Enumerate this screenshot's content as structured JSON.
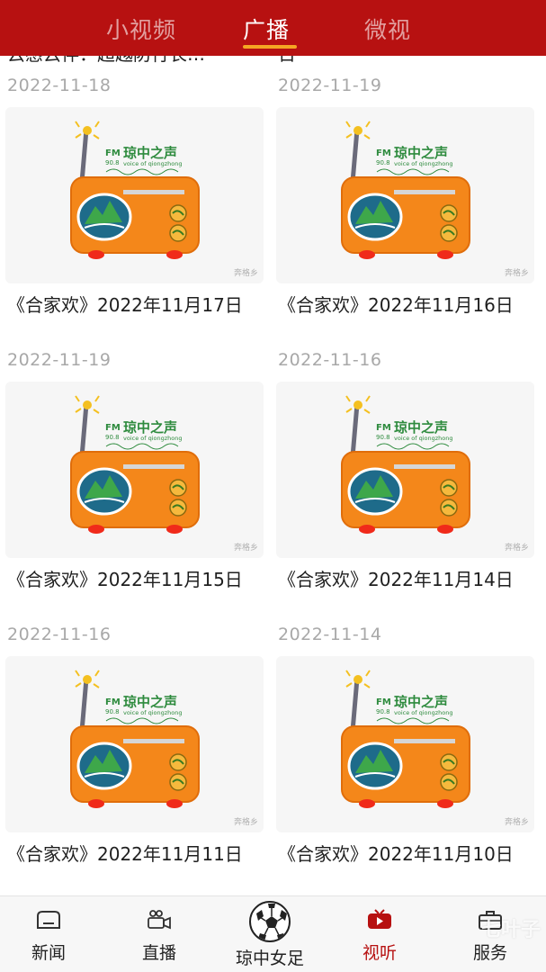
{
  "header": {
    "tabs": [
      {
        "label": "小视频",
        "active": false
      },
      {
        "label": "广播",
        "active": true
      },
      {
        "label": "微视",
        "active": false
      }
    ],
    "accent_color": "#b71111",
    "underline_color": "#f5a623"
  },
  "feed": {
    "partial_top": [
      {
        "title": "云感云伴：超越防行长…",
        "date": "2022-11-18"
      },
      {
        "title": "日",
        "date": "2022-11-19"
      }
    ],
    "thumb_logo": {
      "brand": "琼中之声",
      "fm_label": "FM",
      "frequency": "90.8",
      "tagline": "voice of qiongzhong",
      "watermark": "奔格乡"
    },
    "items": [
      {
        "title": "《合家欢》2022年11月17日",
        "date": "2022-11-19"
      },
      {
        "title": "《合家欢》2022年11月16日",
        "date": "2022-11-16"
      },
      {
        "title": "《合家欢》2022年11月15日",
        "date": "2022-11-16"
      },
      {
        "title": "《合家欢》2022年11月14日",
        "date": "2022-11-14"
      },
      {
        "title": "《合家欢》2022年11月11日",
        "date": ""
      },
      {
        "title": "《合家欢》2022年11月10日",
        "date": ""
      }
    ]
  },
  "bottom_nav": {
    "items": [
      {
        "label": "新闻",
        "icon": "news-icon",
        "active": false
      },
      {
        "label": "直播",
        "icon": "camera-icon",
        "active": false
      },
      {
        "label": "琼中女足",
        "icon": "soccer-ball-icon",
        "active": false
      },
      {
        "label": "视听",
        "icon": "tv-icon",
        "active": true
      },
      {
        "label": "服务",
        "icon": "briefcase-icon",
        "active": false
      }
    ],
    "active_color": "#b71111"
  },
  "overlay_watermark": "七叶子"
}
